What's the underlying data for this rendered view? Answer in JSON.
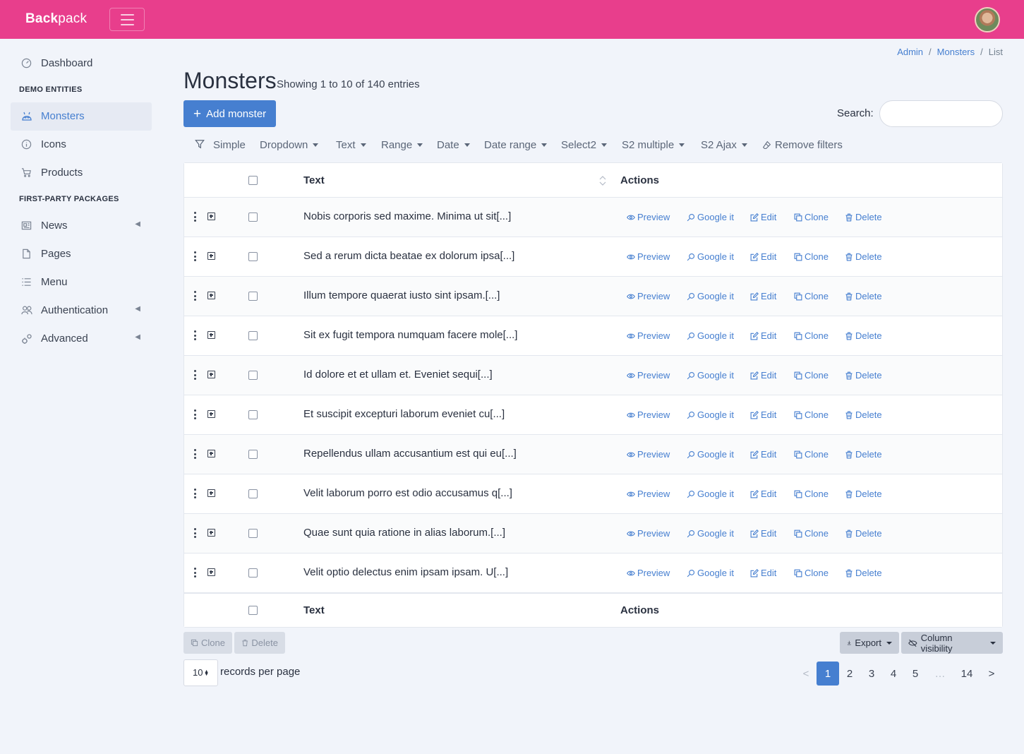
{
  "header": {
    "brand_bold": "Back",
    "brand_rest": "pack"
  },
  "sidebar": {
    "dashboard": "Dashboard",
    "section_demo": "DEMO ENTITIES",
    "monsters": "Monsters",
    "icons": "Icons",
    "products": "Products",
    "section_packages": "FIRST-PARTY PACKAGES",
    "news": "News",
    "pages": "Pages",
    "menu": "Menu",
    "authentication": "Authentication",
    "advanced": "Advanced"
  },
  "breadcrumb": [
    "Admin",
    "Monsters",
    "List"
  ],
  "page": {
    "title": "Monsters",
    "subtitle": "Showing 1 to 10 of 140 entries",
    "add_button": "Add monster",
    "search_label": "Search:",
    "search_value": ""
  },
  "filters": [
    "Simple",
    "Dropdown",
    "Text",
    "Range",
    "Date",
    "Date range",
    "Select2",
    "S2 multiple",
    "S2 Ajax",
    "Remove filters"
  ],
  "table": {
    "col_text": "Text",
    "col_actions": "Actions",
    "actions": [
      "Preview",
      "Google it",
      "Edit",
      "Clone",
      "Delete"
    ],
    "rows": [
      "Nobis corporis sed maxime. Minima ut sit[...]",
      "Sed a rerum dicta beatae ex dolorum ipsa[...]",
      "Illum tempore quaerat iusto sint ipsam.[...]",
      "Sit ex fugit tempora numquam facere mole[...]",
      "Id dolore et et ullam et. Eveniet sequi[...]",
      "Et suscipit excepturi laborum eveniet cu[...]",
      "Repellendus ullam accusantium est qui eu[...]",
      "Velit laborum porro est odio accusamus q[...]",
      "Quae sunt quia ratione in alias laborum.[...]",
      "Velit optio delectus enim ipsam ipsam. U[...]"
    ]
  },
  "bulk": {
    "clone": "Clone",
    "delete": "Delete"
  },
  "toolbar": {
    "export": "Export",
    "column_visibility": "Column visibility"
  },
  "per_page": {
    "value": "10",
    "label": "records per page"
  },
  "pagination": {
    "prev": "<",
    "pages": [
      "1",
      "2",
      "3",
      "4",
      "5"
    ],
    "ellipsis": "…",
    "last": "14",
    "next": ">"
  },
  "colors": {
    "brand": "#e83e8c",
    "primary": "#467fd0",
    "background": "#f1f4fa"
  }
}
